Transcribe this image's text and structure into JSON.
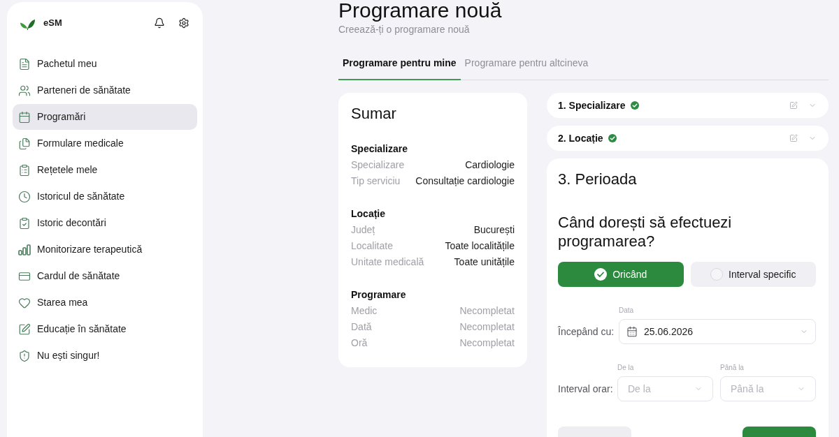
{
  "sidebar": {
    "app_name": "eSM",
    "items": [
      {
        "label": "Pachetul meu",
        "selected": false
      },
      {
        "label": "Parteneri de sănătate",
        "selected": false
      },
      {
        "label": "Programări",
        "selected": true
      },
      {
        "label": "Formulare medicale",
        "selected": false
      },
      {
        "label": "Rețetele mele",
        "selected": false
      },
      {
        "label": "Istoricul de sănătate",
        "selected": false
      },
      {
        "label": "Istoric decontări",
        "selected": false
      },
      {
        "label": "Monitorizare terapeutică",
        "selected": false
      },
      {
        "label": "Cardul de sănătate",
        "selected": false
      },
      {
        "label": "Starea mea",
        "selected": false
      },
      {
        "label": "Educație în sănătate",
        "selected": false
      },
      {
        "label": "Nu ești singur!",
        "selected": false
      }
    ]
  },
  "header": {
    "title": "Programare nouă",
    "subtitle": "Creează-ți o programare nouă"
  },
  "tabs": [
    {
      "label": "Programare pentru mine",
      "selected": true
    },
    {
      "label": "Programare pentru altcineva",
      "selected": false
    }
  ],
  "summary": {
    "title": "Sumar",
    "sections": [
      {
        "heading": "Specializare",
        "rows": [
          {
            "label": "Specializare",
            "value": "Cardiologie",
            "empty": false
          },
          {
            "label": "Tip serviciu",
            "value": "Consultație cardiologie",
            "empty": false
          }
        ]
      },
      {
        "heading": "Locație",
        "rows": [
          {
            "label": "Județ",
            "value": "București",
            "empty": false
          },
          {
            "label": "Localitate",
            "value": "Toate localitățile",
            "empty": false
          },
          {
            "label": "Unitate medicală",
            "value": "Toate unitățile",
            "empty": false
          }
        ]
      },
      {
        "heading": "Programare",
        "rows": [
          {
            "label": "Medic",
            "value": "Necompletat",
            "empty": true
          },
          {
            "label": "Dată",
            "value": "Necompletat",
            "empty": true
          },
          {
            "label": "Oră",
            "value": "Necompletat",
            "empty": true
          }
        ]
      }
    ]
  },
  "steps": [
    {
      "title": "1. Specializare",
      "completed": true
    },
    {
      "title": "2. Locație",
      "completed": true
    }
  ],
  "current_step": {
    "title": "3. Perioada",
    "question": "Când dorești să efectuezi programarea?",
    "options": [
      {
        "label": "Oricând",
        "selected": true
      },
      {
        "label": "Interval specific",
        "selected": false
      }
    ],
    "start_date": {
      "label": "Începând cu:",
      "caption": "Data",
      "value": "25.06.2026"
    },
    "time_range": {
      "label": "Interval orar:",
      "fields": [
        {
          "caption": "De la",
          "placeholder": "De la"
        },
        {
          "caption": "Până la",
          "placeholder": "Până la"
        }
      ]
    },
    "buttons": [
      {
        "kind": "secondary"
      },
      {
        "kind": "primary"
      }
    ]
  }
}
